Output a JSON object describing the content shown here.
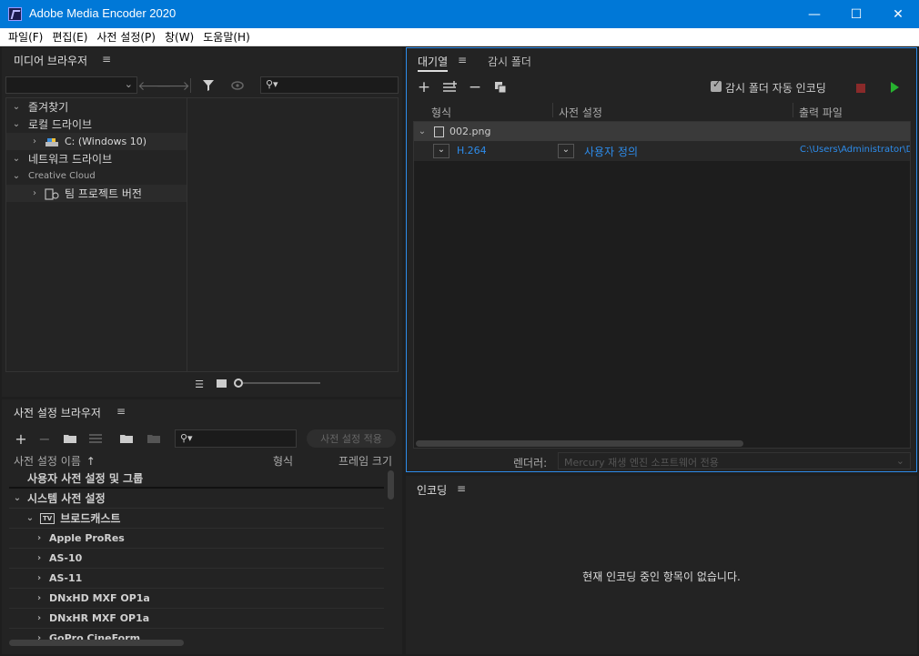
{
  "window": {
    "title": "Adobe Media Encoder 2020",
    "minimize": "—",
    "maximize": "☐",
    "close": "✕"
  },
  "menu": [
    "파일(F)",
    "편집(E)",
    "사전 설정(P)",
    "창(W)",
    "도움말(H)"
  ],
  "media_browser": {
    "tab": "미디어 브라우저",
    "search_placeholder": "",
    "tree": [
      {
        "label": "즐겨찾기",
        "level": 0,
        "expanded": true
      },
      {
        "label": "로컬 드라이브",
        "level": 0,
        "expanded": true
      },
      {
        "label": "C: (Windows 10)",
        "level": 1,
        "expanded": false
      },
      {
        "label": "네트워크 드라이브",
        "level": 0,
        "expanded": true
      },
      {
        "label": "Creative Cloud",
        "level": 0,
        "expanded": true
      },
      {
        "label": "팀 프로젝트 버전",
        "level": 1,
        "expanded": false
      }
    ]
  },
  "preset_browser": {
    "tab": "사전 설정 브라우저",
    "apply_button": "사전 설정 적용",
    "columns": {
      "name": "사전 설정 이름",
      "format": "형식",
      "frame_size": "프레임 크기"
    },
    "rows": [
      {
        "label": "사용자 사전 설정 및 그룹",
        "level": 0,
        "chevron": ""
      },
      {
        "label": "시스템 사전 설정",
        "level": 0,
        "chevron": "⌄"
      },
      {
        "label": "브로드캐스트",
        "level": 1,
        "chevron": "⌄",
        "icon": "TV"
      },
      {
        "label": "Apple ProRes",
        "level": 2,
        "chevron": "›"
      },
      {
        "label": "AS-10",
        "level": 2,
        "chevron": "›"
      },
      {
        "label": "AS-11",
        "level": 2,
        "chevron": "›"
      },
      {
        "label": "DNxHD MXF OP1a",
        "level": 2,
        "chevron": "›"
      },
      {
        "label": "DNxHR MXF OP1a",
        "level": 2,
        "chevron": "›"
      },
      {
        "label": "GoPro CineForm",
        "level": 2,
        "chevron": "›"
      }
    ]
  },
  "queue": {
    "tabs": [
      "대기열",
      "감시 폴더"
    ],
    "auto_encode_label": "감시 폴더 자동 인코딩",
    "columns": {
      "format": "형식",
      "preset": "사전 설정",
      "output": "출력 파일"
    },
    "source_file": "002.png",
    "item": {
      "format": "H.264",
      "preset": "사용자 정의",
      "output": "C:\\Users\\Administrator\\Doc"
    },
    "renderer_label": "렌더러:",
    "renderer_value": "Mercury 재생 엔진 소프트웨어 전용"
  },
  "encoding": {
    "tab": "인코딩",
    "empty_message": "현재 인코딩 중인 항목이 없습니다."
  },
  "colors": {
    "accent": "#0078d7",
    "link": "#2d8ceb",
    "play": "#27b22f",
    "stop": "#8a2a2a"
  }
}
